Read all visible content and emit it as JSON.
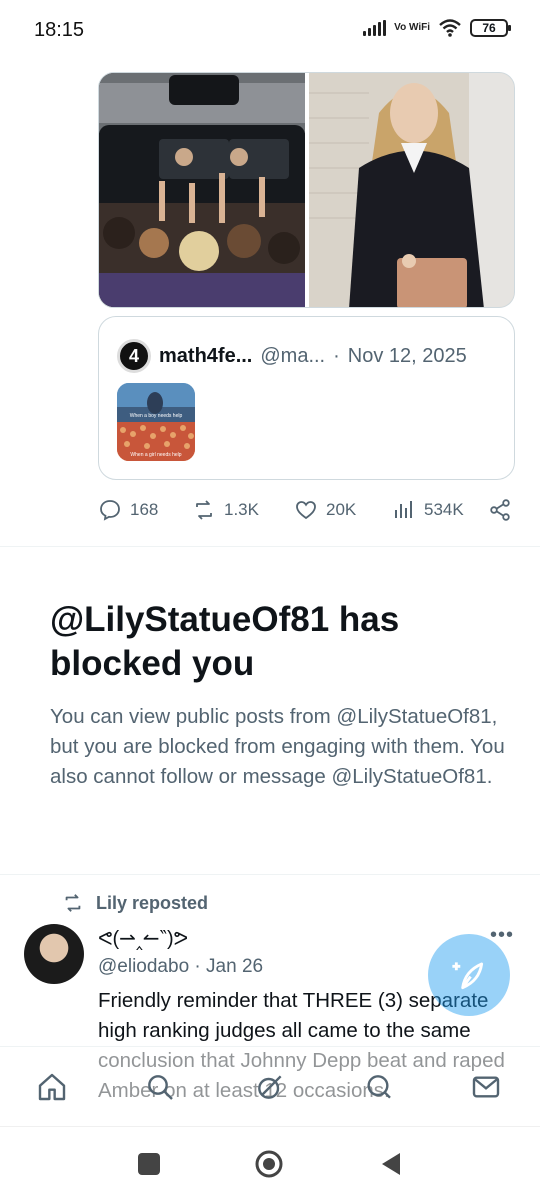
{
  "status_bar": {
    "time": "18:15",
    "network": "Vo WiFi",
    "battery": "76"
  },
  "media": {
    "left_icon": "crowd-photo",
    "right_icon": "portrait-photo"
  },
  "quoted_post": {
    "avatar_text": "4",
    "name": "math4fe...",
    "handle": "@ma...",
    "separator": "·",
    "date": "Nov 12, 2025",
    "thumb_caption_top": "When a boy needs help",
    "thumb_caption_bottom": "When a girl needs help"
  },
  "actions": {
    "replies": "168",
    "reposts": "1.3K",
    "likes": "20K",
    "views": "534K"
  },
  "blocked": {
    "title": "@LilyStatueOf81 has blocked you",
    "body": "You can view public posts from @LilyStatueOf81, but you are blocked from engaging with them. You also cannot follow or message @LilyStatueOf81."
  },
  "repost": {
    "label": "Lily reposted",
    "author_name": "ᕙ(⇀‸↼‶)ᕗ",
    "handle": "@eliodabo",
    "separator": "·",
    "date": "Jan 26",
    "more": "•••",
    "text": "Friendly reminder that THREE (3) separate high ranking judges all came to the same conclusion that Johnny Depp beat and raped Amber on at least 12 occasions."
  },
  "tabs": [
    "home-icon",
    "search-icon",
    "grok-icon",
    "communities-icon",
    "messages-icon"
  ],
  "colors": {
    "accent": "#1d9bf0",
    "secondary_text": "#536471",
    "primary_text": "#0f1419"
  }
}
